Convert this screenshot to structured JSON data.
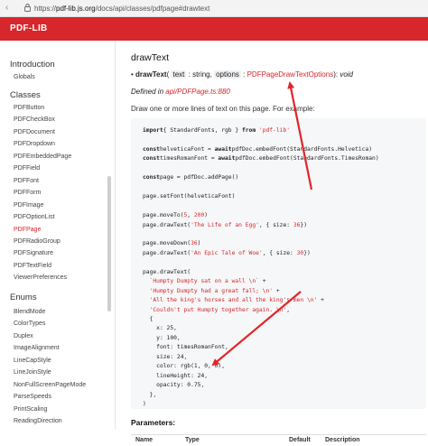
{
  "browser": {
    "url_scheme": "https://",
    "url_host": "pdf-lib.js.org",
    "url_path": "/docs/api/classes/pdfpage#drawtext"
  },
  "brand": "PDF-LIB",
  "sidebar": {
    "intro_heading": "Introduction",
    "globals": "Globals",
    "classes_heading": "Classes",
    "classes": [
      "PDFButton",
      "PDFCheckBox",
      "PDFDocument",
      "PDFDropdown",
      "PDFEmbeddedPage",
      "PDFField",
      "PDFFont",
      "PDFForm",
      "PDFImage",
      "PDFOptionList",
      "PDFPage",
      "PDFRadioGroup",
      "PDFSignature",
      "PDFTextField",
      "ViewerPreferences"
    ],
    "active": "PDFPage",
    "enums_heading": "Enums",
    "enums": [
      "BlendMode",
      "ColorTypes",
      "Duplex",
      "ImageAlignment",
      "LineCapStyle",
      "LineJoinStyle",
      "NonFullScreenPageMode",
      "ParseSpeeds",
      "PrintScaling",
      "ReadingDirection"
    ]
  },
  "method": {
    "title": "drawText",
    "bullet": "•",
    "name": "drawText",
    "open_paren": "(",
    "param1": "text",
    "param1_type": ": string,",
    "param2": "options",
    "param2_colon": ":",
    "param2_type": "PDFPageDrawTextOptions",
    "close_paren": "):",
    "return_type": "void",
    "defined_prefix": "Defined in",
    "defined_in": "api/PDFPage.ts:880",
    "description": "Draw one or more lines of text on this page. For example:"
  },
  "code_lines": [
    [
      [
        "kw",
        "import"
      ],
      [
        "",
        "{ StandardFonts, rgb } "
      ],
      [
        "kw",
        "from"
      ],
      [
        "str",
        " 'pdf-lib'"
      ]
    ],
    [],
    [
      [
        "kw",
        "const"
      ],
      [
        "",
        "helveticaFont = "
      ],
      [
        "kw",
        "await"
      ],
      [
        "",
        "pdfDoc.embedFont(StandardFonts.Helvetica)"
      ]
    ],
    [
      [
        "kw",
        "const"
      ],
      [
        "",
        "timesRomanFont = "
      ],
      [
        "kw",
        "await"
      ],
      [
        "",
        "pdfDoc.embedFont(StandardFonts.TimesRoman)"
      ]
    ],
    [],
    [
      [
        "kw",
        "const"
      ],
      [
        "",
        "page = pdfDoc.addPage()"
      ]
    ],
    [],
    [
      [
        "",
        "page.setFont(helveticaFont)"
      ]
    ],
    [],
    [
      [
        "",
        "page.moveTo("
      ],
      [
        "str",
        "5"
      ],
      [
        "",
        ", "
      ],
      [
        "str",
        "200"
      ],
      [
        "",
        ")"
      ]
    ],
    [
      [
        "",
        "page.drawText("
      ],
      [
        "str",
        "'The Life of an Egg'"
      ],
      [
        "",
        ", { size: "
      ],
      [
        "str",
        "36"
      ],
      [
        "",
        "})"
      ]
    ],
    [],
    [
      [
        "",
        "page.moveDown("
      ],
      [
        "str",
        "36"
      ],
      [
        "",
        ")"
      ]
    ],
    [
      [
        "",
        "page.drawText("
      ],
      [
        "str",
        "'An Epic Tale of Woe'"
      ],
      [
        "",
        ", { size: "
      ],
      [
        "str",
        "30"
      ],
      [
        "",
        "})"
      ]
    ],
    [],
    [
      [
        "",
        "page.drawText("
      ]
    ],
    [
      [
        "str",
        "  `Humpty Dumpty sat on a wall \\n` "
      ],
      [
        "",
        "+"
      ]
    ],
    [
      [
        "str",
        "  'Humpty Dumpty had a great fall; \\n' "
      ],
      [
        "",
        "+"
      ]
    ],
    [
      [
        "str",
        "  'All the king's horses and all the king's men \\n' "
      ],
      [
        "",
        "+"
      ]
    ],
    [
      [
        "str",
        "  'Couldn't put Humpty together again. \\n'"
      ],
      [
        "",
        ","
      ]
    ],
    [
      [
        "",
        "  {"
      ]
    ],
    [
      [
        "",
        "    x: 25,"
      ]
    ],
    [
      [
        "",
        "    y: 100,"
      ]
    ],
    [
      [
        "",
        "    font: timesRomanFont,"
      ]
    ],
    [
      [
        "",
        "    size: 24,"
      ]
    ],
    [
      [
        "",
        "    color: rgb(1, 0, 0),"
      ]
    ],
    [
      [
        "",
        "    lineHeight: 24,"
      ]
    ],
    [
      [
        "",
        "    opacity: 0.75,"
      ]
    ],
    [
      [
        "",
        "  },"
      ]
    ],
    [
      [
        "",
        ")"
      ]
    ]
  ],
  "parameters_heading": "Parameters:",
  "table_headers": [
    "Name",
    "Type",
    "Default",
    "Description"
  ],
  "annotation_color": "#e0262c"
}
